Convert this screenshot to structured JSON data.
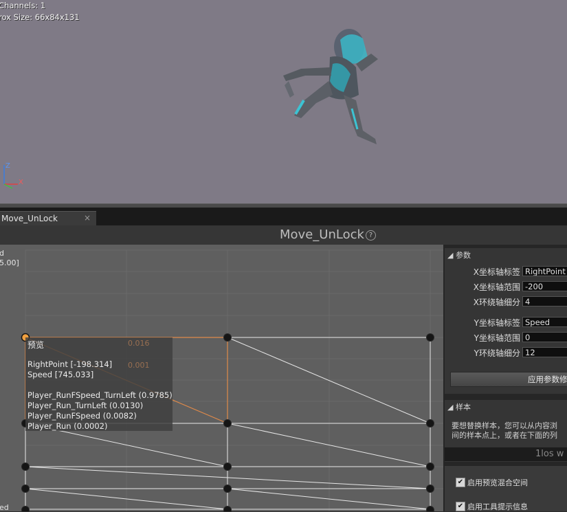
{
  "viewport": {
    "stats": [
      "Channels: 1",
      "rox Size: 66x84x131"
    ],
    "gizmo": {
      "z_label": "Z",
      "x_label": "X"
    }
  },
  "tab": {
    "label": "Move_UnLock",
    "close_glyph": "×"
  },
  "header": {
    "title": "Move_UnLock",
    "help_glyph": "?"
  },
  "graph": {
    "axis_top": [
      "d",
      "5.00]"
    ],
    "axis_bottom": "ed",
    "tooltip": {
      "title": "预览",
      "coords": [
        "RightPoint [-198.314]",
        "Speed [745.033]"
      ],
      "weights": [
        "Player_RunFSpeed_TurnLeft (0.9785)",
        "Player_Run_TurnLeft (0.0130)",
        "Player_RunFSpeed (0.0082)",
        "Player_Run (0.0002)"
      ]
    },
    "ghost_values": [
      "0.016",
      "0.001"
    ],
    "colors": {
      "highlight": "#e08a4a",
      "preview": "#f0a040",
      "line": "#e8e8e8",
      "point": "#151515"
    }
  },
  "params": {
    "header": "参数",
    "x_axis_label": {
      "label": "X坐标轴标签",
      "value": "RightPoint"
    },
    "x_axis_range": {
      "label": "X坐标轴范围",
      "value": "-200"
    },
    "x_divisions": {
      "label": "X环绕轴细分",
      "value": "4"
    },
    "y_axis_label": {
      "label": "Y坐标轴标签",
      "value": "Speed"
    },
    "y_axis_range": {
      "label": "Y坐标轴范围",
      "value": "0"
    },
    "y_divisions": {
      "label": "Y环绕轴细分",
      "value": "12"
    },
    "apply_button": "应用参数修"
  },
  "samples": {
    "header": "样本",
    "desc_line1": "要想替换样本，您可以从内容浏",
    "desc_line2": "间的样本点上，或者在下面的列",
    "hint": "1los w"
  },
  "options": {
    "enable_preview_blend": "启用预览混合空间",
    "enable_tooltips": "启用工具提示信息",
    "check_glyph": "✔"
  }
}
